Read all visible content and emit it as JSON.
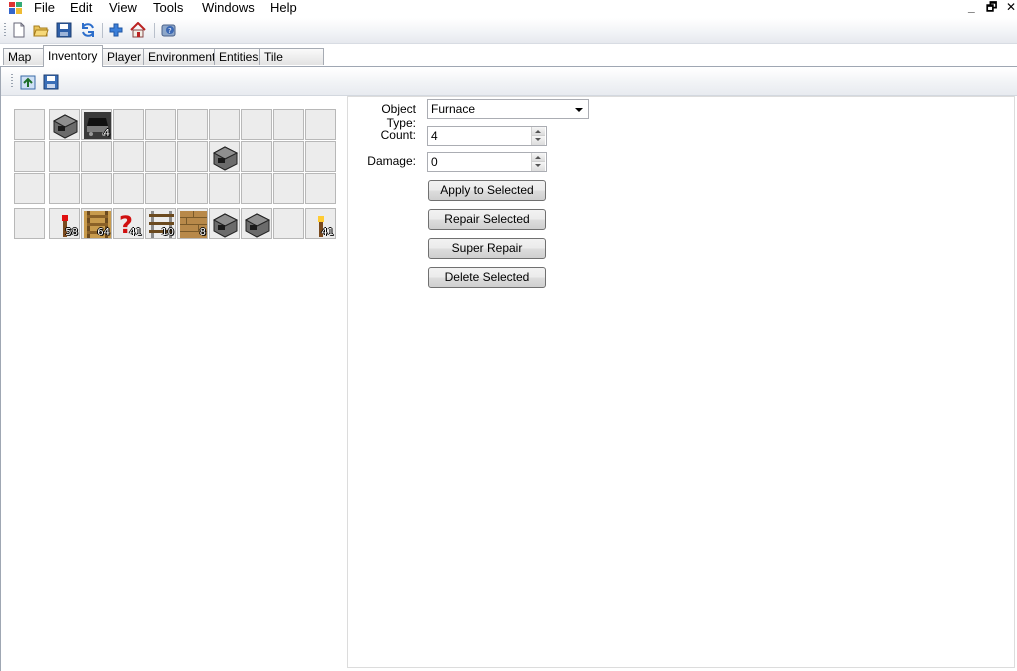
{
  "menu": {
    "items": [
      "File",
      "Edit",
      "View",
      "Tools",
      "Windows",
      "Help"
    ],
    "minimize": "_",
    "restore": "🗗",
    "close": "✕"
  },
  "tabs": [
    {
      "label": "Map",
      "active": false
    },
    {
      "label": "Inventory",
      "active": true
    },
    {
      "label": "Player",
      "active": false
    },
    {
      "label": "Environment",
      "active": false
    },
    {
      "label": "Entities",
      "active": false
    },
    {
      "label": "Tile Entities",
      "active": false
    }
  ],
  "inventory": {
    "main_row1": [
      {
        "icon": "furnace-icon",
        "count": ""
      },
      {
        "icon": "minecart-icon",
        "count": "4"
      }
    ],
    "main_row2_col6": {
      "icon": "furnace-icon",
      "count": ""
    },
    "hotbar": [
      {
        "icon": "redstone-torch-icon",
        "count": "58"
      },
      {
        "icon": "ladder-icon",
        "count": "64"
      },
      {
        "icon": "unknown-item-icon",
        "count": "41"
      },
      {
        "icon": "rail-icon",
        "count": "10"
      },
      {
        "icon": "wood-planks-icon",
        "count": "8"
      },
      {
        "icon": "furnace-icon",
        "count": ""
      },
      {
        "icon": "furnace-icon",
        "count": ""
      },
      {
        "icon": "empty",
        "count": ""
      },
      {
        "icon": "torch-icon",
        "count": "41"
      }
    ]
  },
  "properties": {
    "object_type_label": "Object Type:",
    "object_type_value": "Furnace",
    "count_label": "Count:",
    "count_value": "4",
    "damage_label": "Damage:",
    "damage_value": "0"
  },
  "buttons": {
    "apply": "Apply to Selected",
    "repair": "Repair Selected",
    "super_repair": "Super Repair",
    "delete": "Delete Selected"
  }
}
